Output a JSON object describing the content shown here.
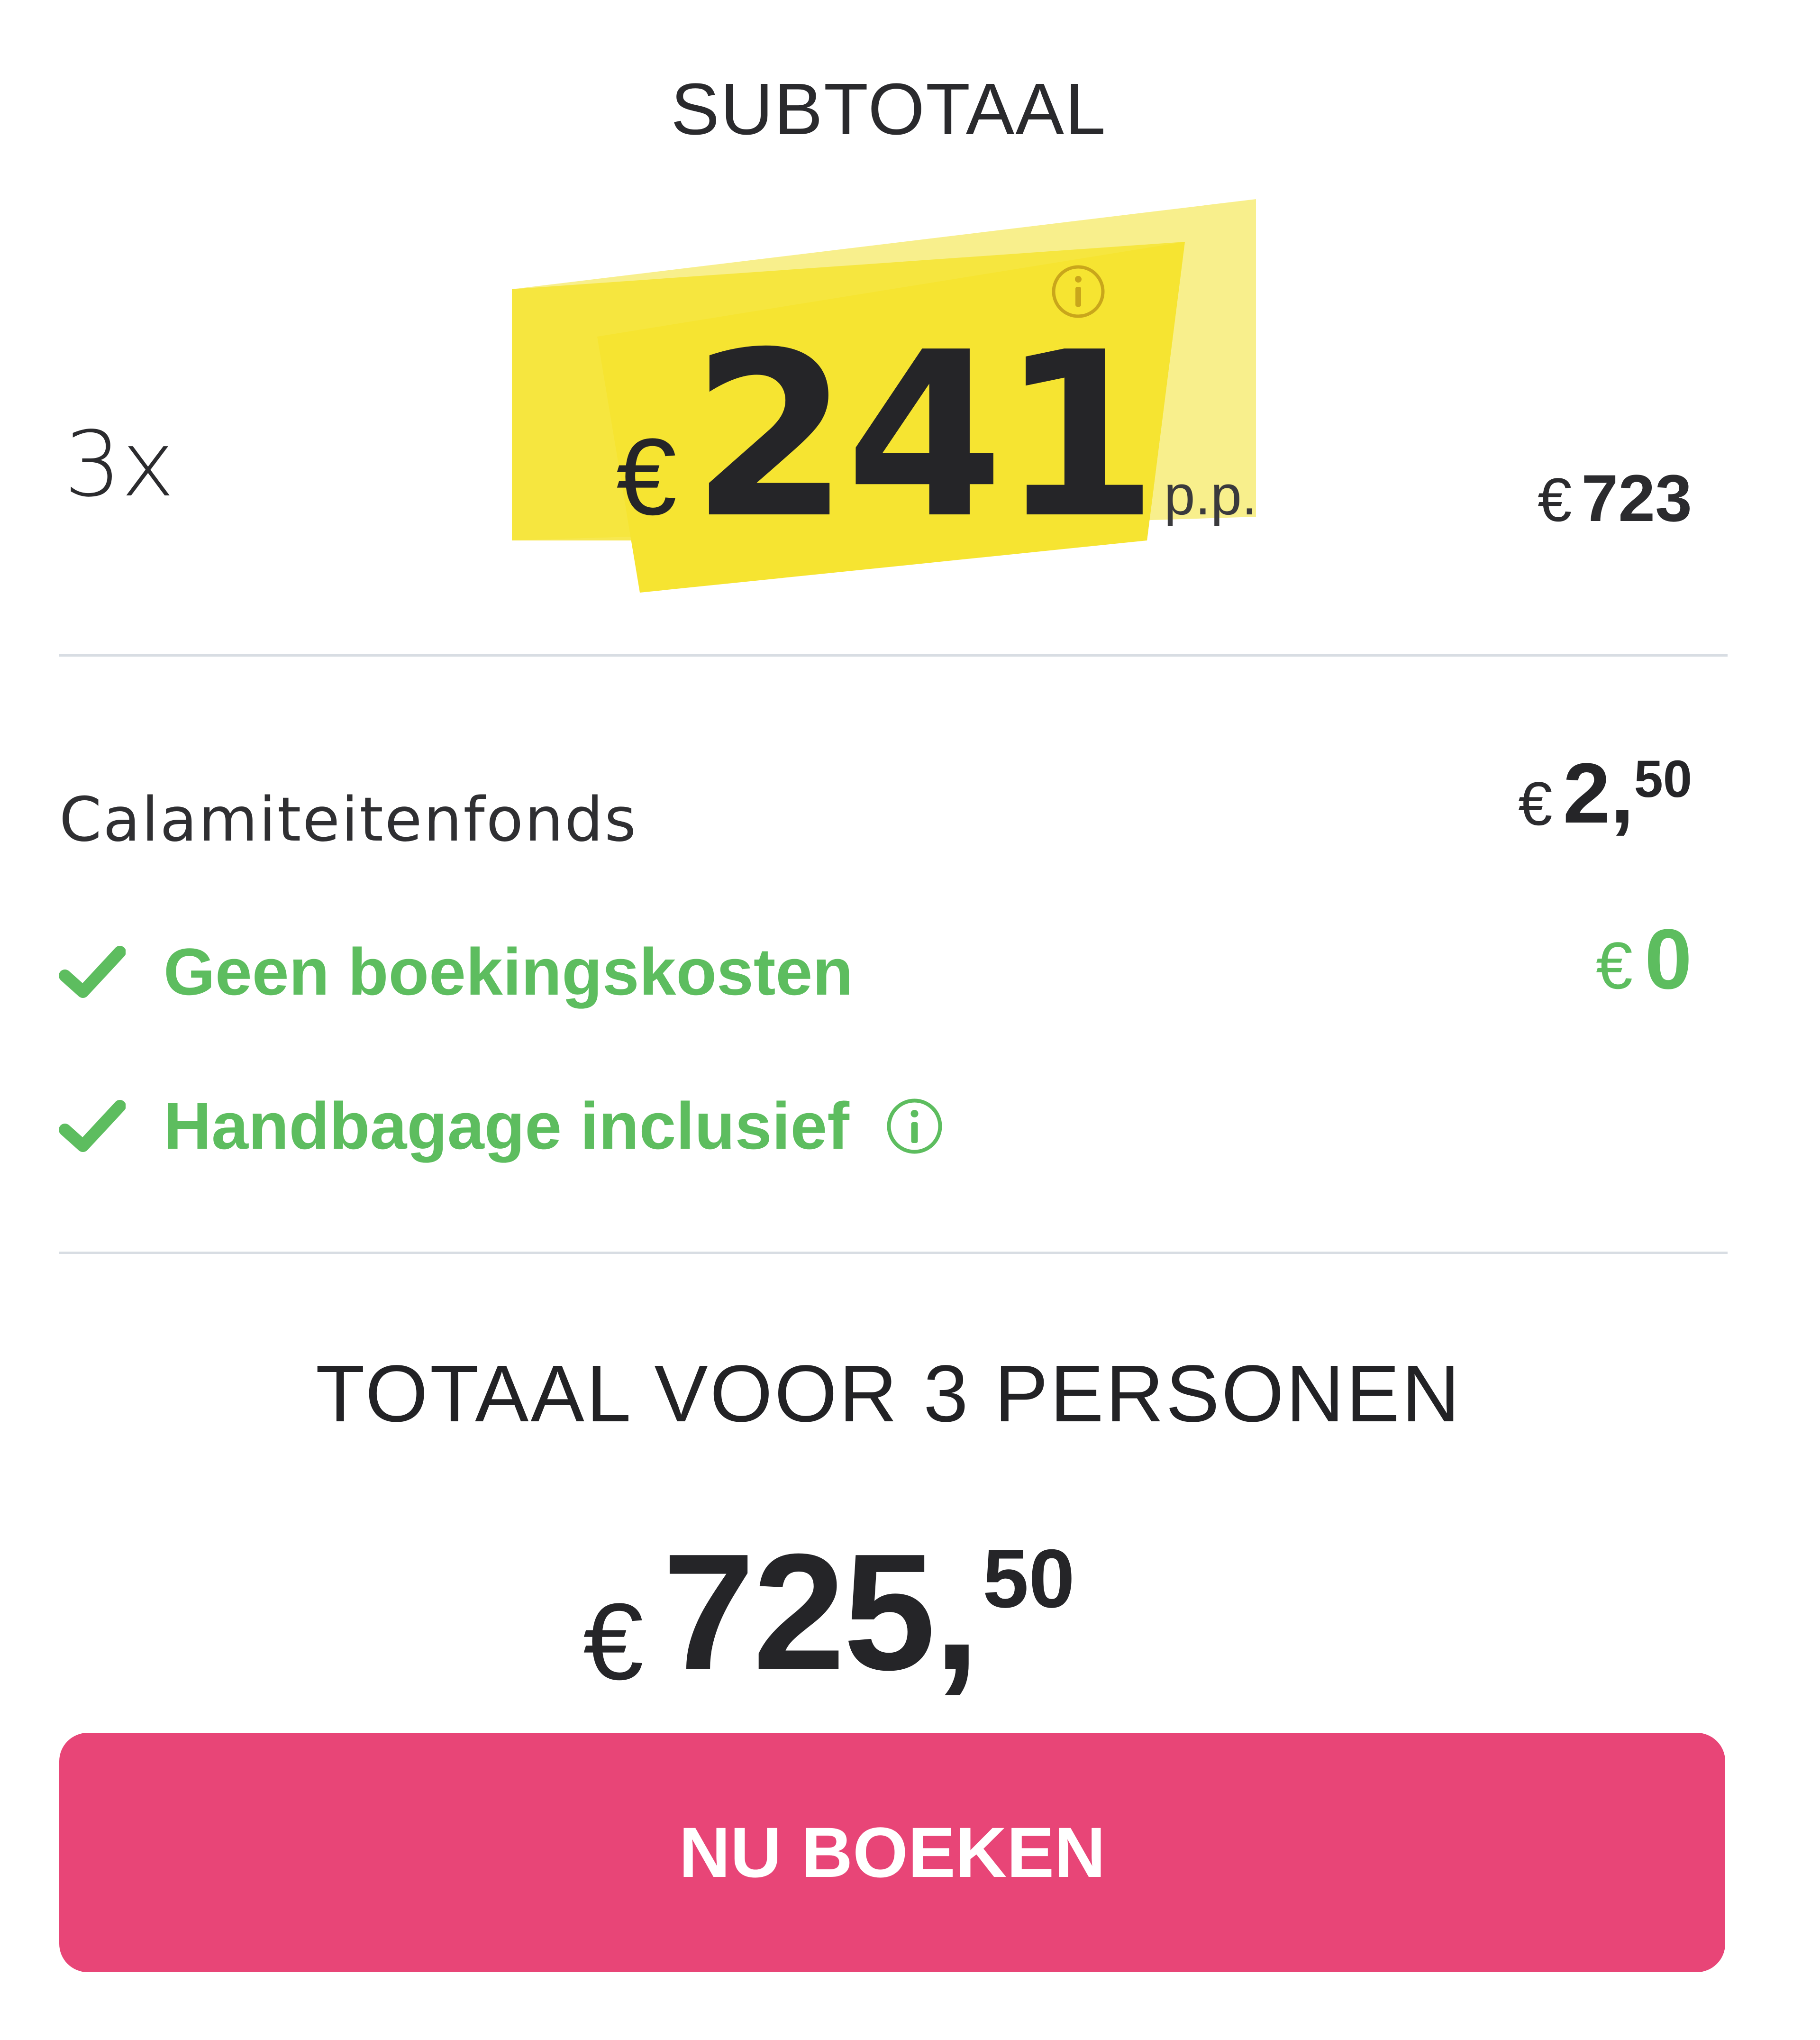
{
  "subtotal": {
    "title": "SUBTOTAAL",
    "quantity": "3x",
    "price_per_person": {
      "currency": "€",
      "amount": "241",
      "suffix": "p.p."
    },
    "line_total": {
      "currency": "€",
      "amount": "723"
    }
  },
  "fees": {
    "calamity_fund": {
      "label": "Calamiteitenfonds",
      "currency": "€",
      "integer": "2,",
      "decimal": "50"
    },
    "booking_costs": {
      "label": "Geen boekingskosten",
      "currency": "€",
      "amount": "0"
    },
    "hand_luggage": {
      "label": "Handbagage inclusief"
    }
  },
  "total": {
    "title": "TOTAAL VOOR 3 PERSONEN",
    "currency": "€",
    "integer": "725,",
    "decimal": "50"
  },
  "actions": {
    "book_label": "NU BOEKEN"
  },
  "colors": {
    "highlight": "#f7e54a",
    "success": "#5dbd5f",
    "primary_button": "#e84577",
    "text": "#252528",
    "divider": "#d8dde3"
  },
  "icons": {
    "info": "info-circle-icon",
    "check": "check-icon"
  }
}
